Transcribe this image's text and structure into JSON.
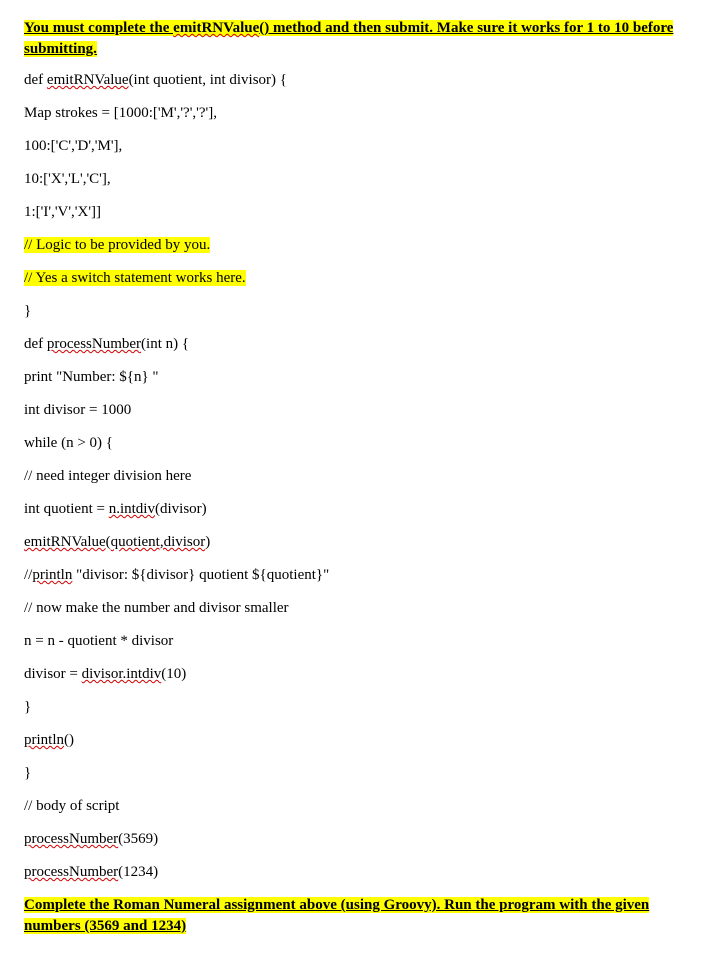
{
  "instruction_top": {
    "t1": "You must complete the ",
    "t2": "emitRNValue",
    "t3": "() method and then submit. Make sure it works for 1 to 10 before submitting."
  },
  "code": {
    "l1a": "def ",
    "l1b": "emitRNValue",
    "l1c": "(int quotient, int divisor) {",
    "l2": "Map strokes = [1000:['M','?','?'],",
    "l3": "100:['C','D','M'],",
    "l4": "10:['X','L','C'],",
    "l5": "1:['I','V','X']]",
    "l6": "// Logic to be provided by you.",
    "l7": "// Yes a switch statement works here.",
    "l8": "}",
    "l9a": "def ",
    "l9b": "processNumber",
    "l9c": "(int n) {",
    "l10": "print \"Number: ${n} \"",
    "l11": "int divisor = 1000",
    "l12": "while (n > 0) {",
    "l13": "// need integer division here",
    "l14a": "int quotient = ",
    "l14b": "n.intdiv",
    "l14c": "(divisor)",
    "l15a": "emitRNValue",
    "l15b": "(",
    "l15c": "quotient,divisor",
    "l15d": ")",
    "l16a": "//",
    "l16b": "println",
    "l16c": " \"divisor: ${divisor} quotient ${quotient}\"",
    "l17": "// now make the number and divisor smaller",
    "l18": "n = n - quotient * divisor",
    "l19a": "divisor = ",
    "l19b": "divisor.intdiv",
    "l19c": "(10)",
    "l20": "}",
    "l21a": "println",
    "l21b": "()",
    "l22": "}",
    "l23": "// body of script",
    "l24a": "processNumber",
    "l24b": "(3569)",
    "l25a": "processNumber",
    "l25b": "(1234)"
  },
  "instruction_bottom": {
    "b1": "Complete the Roman Numeral assignment above (using Groovy). Run the program with the given numbers (3569 and 1234)"
  }
}
